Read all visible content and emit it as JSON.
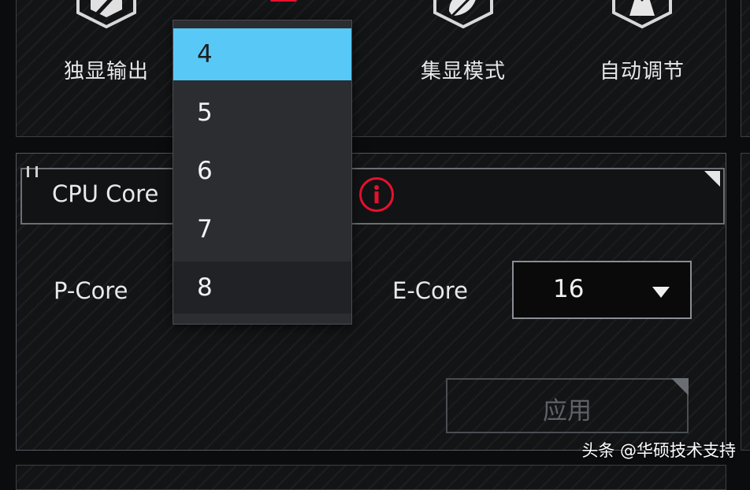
{
  "modes": [
    {
      "label": "独显输出",
      "icon": "gpu-output-icon"
    },
    {
      "label": "",
      "icon": "mode-selected-red-icon"
    },
    {
      "label": "集显模式",
      "icon": "leaf-eco-icon"
    },
    {
      "label": "自动调节",
      "icon": "auto-adjust-icon"
    }
  ],
  "section": {
    "title": "CPU Core",
    "info_icon": "info-icon"
  },
  "p_core": {
    "label": "P-Core"
  },
  "e_core": {
    "label": "E-Core",
    "value": "16"
  },
  "dropdown": {
    "options": [
      "4",
      "5",
      "6",
      "7",
      "8"
    ],
    "selected": "4",
    "hovered": "8"
  },
  "apply_label": "应用",
  "watermark": "头条 @华硕技术支持",
  "colors": {
    "accent_blue": "#58c8f7",
    "alert_red": "#e8112d",
    "panel_bg": "#131416"
  }
}
